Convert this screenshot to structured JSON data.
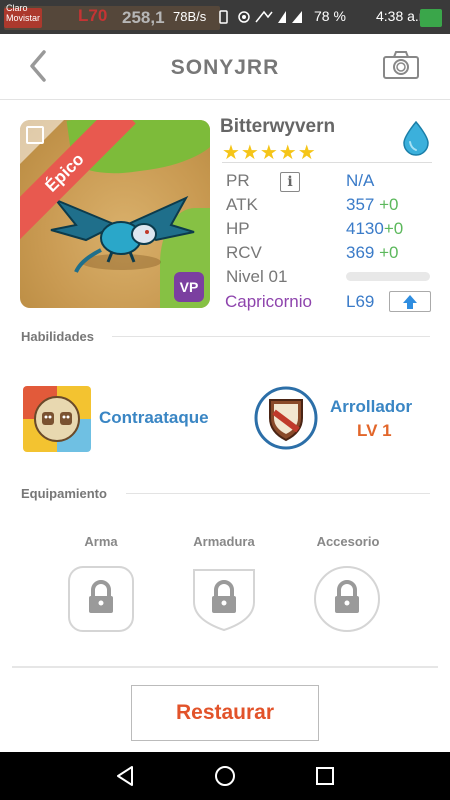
{
  "status_bar": {
    "carrier": "Claro\nMovistar",
    "game_level": "L70",
    "game_score": "258,1",
    "net_speed": "78B/s",
    "battery": "78 %",
    "time": "4:38 a.m."
  },
  "header": {
    "title": "SONYJRR"
  },
  "monster": {
    "rarity": "Épico",
    "name": "Bitterwyvern",
    "stars": "★★★★★",
    "element_icon": "water-drop-icon",
    "stats": {
      "pr_label": "PR",
      "pr_info": "i",
      "pr_value": "N/A",
      "atk_label": "ATK",
      "atk_value": "357",
      "atk_bonus": "+0",
      "hp_label": "HP",
      "hp_value": "4130",
      "hp_bonus": "+0",
      "rcv_label": "RCV",
      "rcv_value": "369",
      "rcv_bonus": "+0",
      "level_label": "Nivel 01",
      "level_progress": 0
    },
    "sign_label": "Capricornio",
    "sign_level": "L69",
    "badge": "VP"
  },
  "skills": {
    "section_title": "Habilidades",
    "skill1": {
      "name": "Contraataque"
    },
    "skill2": {
      "name": "Arrollador",
      "level": "LV 1"
    }
  },
  "equipment": {
    "section_title": "Equipamiento",
    "slots": [
      {
        "label": "Arma"
      },
      {
        "label": "Armadura"
      },
      {
        "label": "Accesorio"
      }
    ]
  },
  "actions": {
    "restore_label": "Restaurar"
  },
  "colors": {
    "accent_blue": "#3a86c4",
    "level_orange": "#e2662a",
    "restore_red": "#e2532a",
    "sign_purple": "#8e44ad",
    "bonus_green": "#5cb85c",
    "star_yellow": "#f5c518"
  }
}
